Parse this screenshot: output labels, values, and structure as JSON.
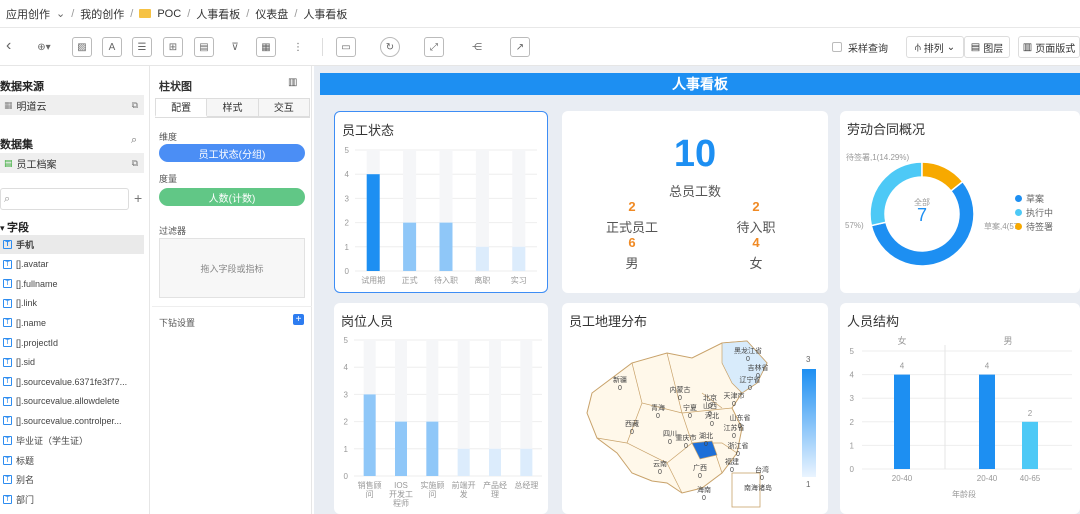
{
  "breadcrumb": {
    "items": [
      "应用创作",
      "我的创作",
      "POC",
      "人事看板",
      "仪表盘",
      "人事看板"
    ]
  },
  "toolbar": {
    "sample_query": "采样查询",
    "arrange": "排列",
    "layers": "图层",
    "page_layout": "页面版式"
  },
  "sidebar": {
    "datasource_title": "数据来源",
    "datasource_name": "明道云",
    "dataset_title": "数据集",
    "dataset_name": "员工档案",
    "fields_title": "字段",
    "fields": [
      "手机",
      "[].avatar",
      "[].fullname",
      "[].link",
      "[].name",
      "[].projectId",
      "[].sid",
      "[].sourcevalue.6371fe3f77...",
      "[].sourcevalue.allowdelete",
      "[].sourcevalue.controlper...",
      "毕业证（学生证）",
      "标题",
      "别名",
      "部门"
    ]
  },
  "config": {
    "title": "柱状图",
    "tabs": [
      "配置",
      "样式",
      "交互"
    ],
    "dimension_label": "维度",
    "dimension_value": "员工状态(分组)",
    "measure_label": "度量",
    "measure_value": "人数(计数)",
    "filter_label": "过滤器",
    "filter_placeholder": "拖入字段或指标",
    "drill_label": "下钻设置"
  },
  "dashboard": {
    "title": "人事看板",
    "status": {
      "title": "员工状态",
      "chart_data": {
        "type": "bar",
        "categories": [
          "试用期",
          "正式",
          "待入职",
          "离职",
          "实习"
        ],
        "values": [
          4,
          2,
          2,
          1,
          1
        ],
        "ylim": [
          0,
          5
        ]
      }
    },
    "kpi": {
      "total_value": "10",
      "total_label": "总员工数",
      "formal_value": "2",
      "formal_label": "正式员工",
      "pending_value": "2",
      "pending_label": "待入职",
      "male_value": "6",
      "male_label": "男",
      "female_value": "4",
      "female_label": "女"
    },
    "contract": {
      "title": "劳动合同概况",
      "center_label": "全部",
      "center_value": "7",
      "label_top": "待签署,1(14.29%)",
      "label_left": "57%)",
      "label_right": "草案,4(57",
      "legend": [
        "草案",
        "执行中",
        "待签署"
      ],
      "colors": [
        "#1d8ff2",
        "#4dc9f6",
        "#f7a900"
      ],
      "chart_data": {
        "type": "pie",
        "categories": [
          "草案",
          "执行中",
          "待签署"
        ],
        "values": [
          4,
          2,
          1
        ]
      }
    },
    "positions": {
      "title": "岗位人员",
      "chart_data": {
        "type": "bar",
        "categories": [
          "销售顾问",
          "IOS开发工程师",
          "实施顾问",
          "前端开发",
          "产品经理",
          "总经理"
        ],
        "values": [
          3,
          2,
          2,
          1,
          1,
          1
        ],
        "ylim": [
          0,
          5
        ]
      },
      "tick_lines": [
        [
          "销售顾",
          "问"
        ],
        [
          "IOS",
          "开发工",
          "程师"
        ],
        [
          "实施顾",
          "问"
        ],
        [
          "前端开",
          "发"
        ],
        [
          "产品经",
          "理"
        ],
        [
          "总经理"
        ]
      ]
    },
    "geo": {
      "title": "员工地理分布",
      "legend_max": "3",
      "legend_min": "1",
      "labels": [
        {
          "name": "黑龙江省",
          "value": "0"
        },
        {
          "name": "吉林省",
          "value": "0"
        },
        {
          "name": "辽宁省",
          "value": "0"
        },
        {
          "name": "新疆",
          "value": "0"
        },
        {
          "name": "内蒙古",
          "value": "0"
        },
        {
          "name": "北京",
          "value": "0"
        },
        {
          "name": "天津市",
          "value": "0"
        },
        {
          "name": "青海",
          "value": "0"
        },
        {
          "name": "宁夏",
          "value": "0"
        },
        {
          "name": "山西",
          "value": "0"
        },
        {
          "name": "河北",
          "value": "0"
        },
        {
          "name": "山东省",
          "value": "0"
        },
        {
          "name": "江苏省",
          "value": "0"
        },
        {
          "name": "西藏",
          "value": "0"
        },
        {
          "name": "四川",
          "value": "0"
        },
        {
          "name": "湖北",
          "value": "0"
        },
        {
          "name": "重庆市",
          "value": "0"
        },
        {
          "name": "浙江省",
          "value": "0"
        },
        {
          "name": "云南",
          "value": "0"
        },
        {
          "name": "广西",
          "value": "0"
        },
        {
          "name": "福建",
          "value": "0"
        },
        {
          "name": "台湾",
          "value": "0"
        },
        {
          "name": "海南",
          "value": "0"
        },
        {
          "name": "南海诸岛",
          "value": ""
        }
      ]
    },
    "structure": {
      "title": "人员结构",
      "groups": [
        "女",
        "男"
      ],
      "xlabel": "年龄段",
      "chart_data": {
        "type": "bar",
        "categories": [
          "20-40",
          "20-40",
          "40-65"
        ],
        "series": [
          {
            "values": [
              4,
              4,
              2
            ]
          }
        ],
        "ylim": [
          0,
          5
        ]
      },
      "bar_colors": [
        "#1d8ff2",
        "#1d8ff2",
        "#4dc9f6"
      ]
    }
  }
}
